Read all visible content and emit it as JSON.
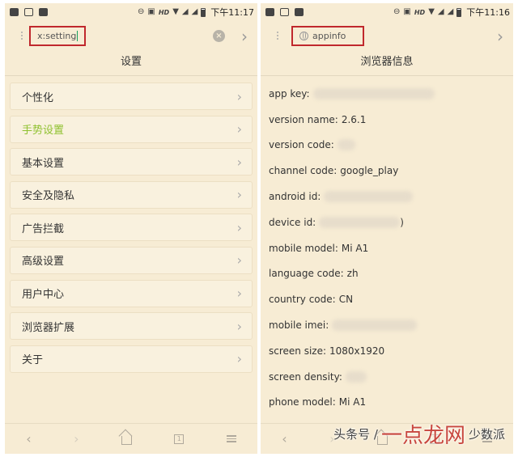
{
  "left": {
    "status": {
      "time": "下午11:17",
      "hd": "HD"
    },
    "url": {
      "text": "x:setting"
    },
    "title": "设置",
    "menu": [
      {
        "label": "个性化",
        "active": false
      },
      {
        "label": "手势设置",
        "active": true
      },
      {
        "label": "基本设置",
        "active": false
      },
      {
        "label": "安全及隐私",
        "active": false
      },
      {
        "label": "广告拦截",
        "active": false
      },
      {
        "label": "高级设置",
        "active": false
      },
      {
        "label": "用户中心",
        "active": false
      },
      {
        "label": "浏览器扩展",
        "active": false
      },
      {
        "label": "关于",
        "active": false
      }
    ]
  },
  "right": {
    "status": {
      "time": "下午11:16",
      "hd": "HD"
    },
    "url": {
      "text": "appinfo"
    },
    "title": "浏览器信息",
    "rows": [
      {
        "label": "app key:",
        "value": ""
      },
      {
        "label": "version name:",
        "value": "2.6.1"
      },
      {
        "label": "version code:",
        "value": ""
      },
      {
        "label": "channel code:",
        "value": "google_play"
      },
      {
        "label": "android id:",
        "value": ""
      },
      {
        "label": "device id:",
        "value": ")"
      },
      {
        "label": "mobile model:",
        "value": "Mi A1"
      },
      {
        "label": "language code:",
        "value": "zh"
      },
      {
        "label": "country code:",
        "value": "CN"
      },
      {
        "label": "mobile imei:",
        "value": ""
      },
      {
        "label": "screen size:",
        "value": "1080x1920"
      },
      {
        "label": "screen density:",
        "value": ""
      },
      {
        "label": "phone model:",
        "value": "Mi A1"
      }
    ]
  },
  "watermark": {
    "prefix": "头条号 /",
    "brand": "一点龙网",
    "suffix": "少数派"
  },
  "colors": {
    "accent_red": "#c0282d",
    "active_green": "#8fc130",
    "panel_bg": "#f7ecd4"
  }
}
